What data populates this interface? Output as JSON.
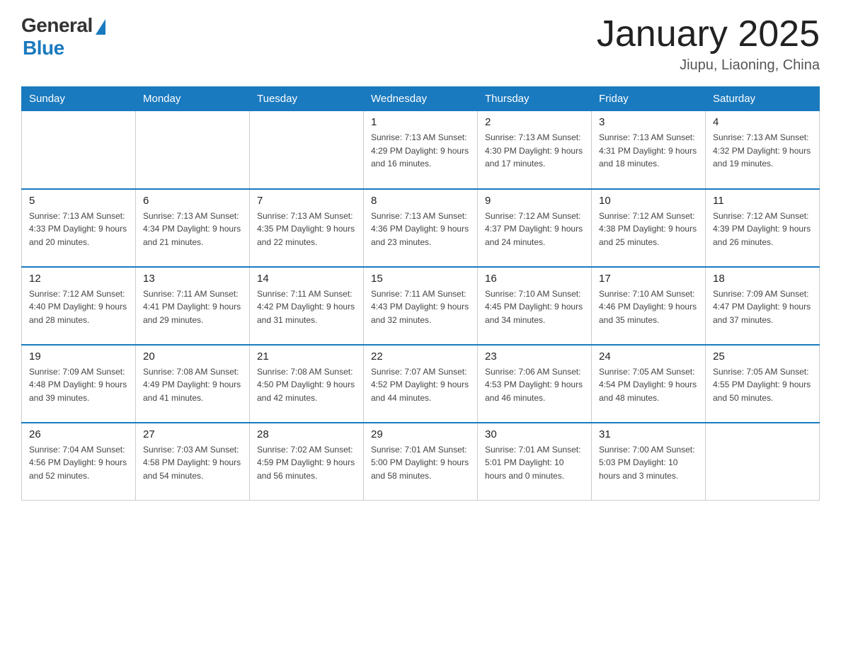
{
  "logo": {
    "general": "General",
    "blue": "Blue"
  },
  "title": "January 2025",
  "subtitle": "Jiupu, Liaoning, China",
  "headers": [
    "Sunday",
    "Monday",
    "Tuesday",
    "Wednesday",
    "Thursday",
    "Friday",
    "Saturday"
  ],
  "weeks": [
    [
      {
        "day": "",
        "info": ""
      },
      {
        "day": "",
        "info": ""
      },
      {
        "day": "",
        "info": ""
      },
      {
        "day": "1",
        "info": "Sunrise: 7:13 AM\nSunset: 4:29 PM\nDaylight: 9 hours\nand 16 minutes."
      },
      {
        "day": "2",
        "info": "Sunrise: 7:13 AM\nSunset: 4:30 PM\nDaylight: 9 hours\nand 17 minutes."
      },
      {
        "day": "3",
        "info": "Sunrise: 7:13 AM\nSunset: 4:31 PM\nDaylight: 9 hours\nand 18 minutes."
      },
      {
        "day": "4",
        "info": "Sunrise: 7:13 AM\nSunset: 4:32 PM\nDaylight: 9 hours\nand 19 minutes."
      }
    ],
    [
      {
        "day": "5",
        "info": "Sunrise: 7:13 AM\nSunset: 4:33 PM\nDaylight: 9 hours\nand 20 minutes."
      },
      {
        "day": "6",
        "info": "Sunrise: 7:13 AM\nSunset: 4:34 PM\nDaylight: 9 hours\nand 21 minutes."
      },
      {
        "day": "7",
        "info": "Sunrise: 7:13 AM\nSunset: 4:35 PM\nDaylight: 9 hours\nand 22 minutes."
      },
      {
        "day": "8",
        "info": "Sunrise: 7:13 AM\nSunset: 4:36 PM\nDaylight: 9 hours\nand 23 minutes."
      },
      {
        "day": "9",
        "info": "Sunrise: 7:12 AM\nSunset: 4:37 PM\nDaylight: 9 hours\nand 24 minutes."
      },
      {
        "day": "10",
        "info": "Sunrise: 7:12 AM\nSunset: 4:38 PM\nDaylight: 9 hours\nand 25 minutes."
      },
      {
        "day": "11",
        "info": "Sunrise: 7:12 AM\nSunset: 4:39 PM\nDaylight: 9 hours\nand 26 minutes."
      }
    ],
    [
      {
        "day": "12",
        "info": "Sunrise: 7:12 AM\nSunset: 4:40 PM\nDaylight: 9 hours\nand 28 minutes."
      },
      {
        "day": "13",
        "info": "Sunrise: 7:11 AM\nSunset: 4:41 PM\nDaylight: 9 hours\nand 29 minutes."
      },
      {
        "day": "14",
        "info": "Sunrise: 7:11 AM\nSunset: 4:42 PM\nDaylight: 9 hours\nand 31 minutes."
      },
      {
        "day": "15",
        "info": "Sunrise: 7:11 AM\nSunset: 4:43 PM\nDaylight: 9 hours\nand 32 minutes."
      },
      {
        "day": "16",
        "info": "Sunrise: 7:10 AM\nSunset: 4:45 PM\nDaylight: 9 hours\nand 34 minutes."
      },
      {
        "day": "17",
        "info": "Sunrise: 7:10 AM\nSunset: 4:46 PM\nDaylight: 9 hours\nand 35 minutes."
      },
      {
        "day": "18",
        "info": "Sunrise: 7:09 AM\nSunset: 4:47 PM\nDaylight: 9 hours\nand 37 minutes."
      }
    ],
    [
      {
        "day": "19",
        "info": "Sunrise: 7:09 AM\nSunset: 4:48 PM\nDaylight: 9 hours\nand 39 minutes."
      },
      {
        "day": "20",
        "info": "Sunrise: 7:08 AM\nSunset: 4:49 PM\nDaylight: 9 hours\nand 41 minutes."
      },
      {
        "day": "21",
        "info": "Sunrise: 7:08 AM\nSunset: 4:50 PM\nDaylight: 9 hours\nand 42 minutes."
      },
      {
        "day": "22",
        "info": "Sunrise: 7:07 AM\nSunset: 4:52 PM\nDaylight: 9 hours\nand 44 minutes."
      },
      {
        "day": "23",
        "info": "Sunrise: 7:06 AM\nSunset: 4:53 PM\nDaylight: 9 hours\nand 46 minutes."
      },
      {
        "day": "24",
        "info": "Sunrise: 7:05 AM\nSunset: 4:54 PM\nDaylight: 9 hours\nand 48 minutes."
      },
      {
        "day": "25",
        "info": "Sunrise: 7:05 AM\nSunset: 4:55 PM\nDaylight: 9 hours\nand 50 minutes."
      }
    ],
    [
      {
        "day": "26",
        "info": "Sunrise: 7:04 AM\nSunset: 4:56 PM\nDaylight: 9 hours\nand 52 minutes."
      },
      {
        "day": "27",
        "info": "Sunrise: 7:03 AM\nSunset: 4:58 PM\nDaylight: 9 hours\nand 54 minutes."
      },
      {
        "day": "28",
        "info": "Sunrise: 7:02 AM\nSunset: 4:59 PM\nDaylight: 9 hours\nand 56 minutes."
      },
      {
        "day": "29",
        "info": "Sunrise: 7:01 AM\nSunset: 5:00 PM\nDaylight: 9 hours\nand 58 minutes."
      },
      {
        "day": "30",
        "info": "Sunrise: 7:01 AM\nSunset: 5:01 PM\nDaylight: 10 hours\nand 0 minutes."
      },
      {
        "day": "31",
        "info": "Sunrise: 7:00 AM\nSunset: 5:03 PM\nDaylight: 10 hours\nand 3 minutes."
      },
      {
        "day": "",
        "info": ""
      }
    ]
  ]
}
